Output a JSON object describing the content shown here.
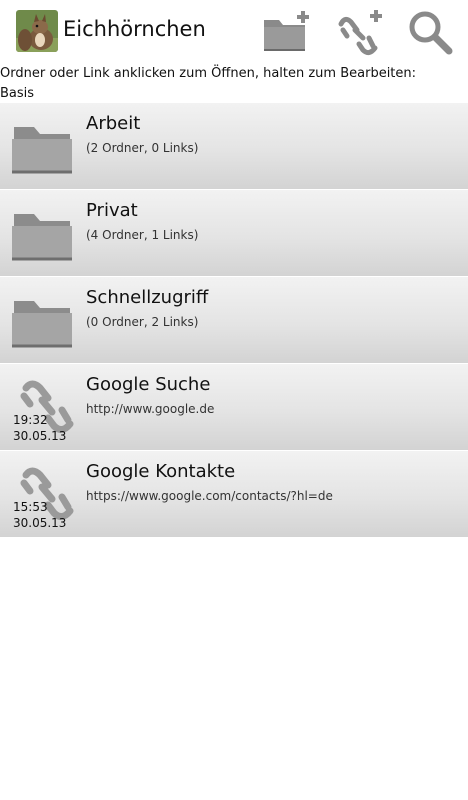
{
  "header": {
    "title": "Eichhörnchen",
    "app_icon": "squirrel-photo",
    "actions": [
      {
        "name": "add-folder-button",
        "icon": "folder-plus-icon"
      },
      {
        "name": "add-link-button",
        "icon": "link-plus-icon"
      },
      {
        "name": "search-button",
        "icon": "search-icon"
      }
    ]
  },
  "hint": "Ordner oder Link anklicken zum Öffnen, halten zum Bearbeiten:",
  "breadcrumb": "Basis",
  "items": [
    {
      "type": "folder",
      "icon": "folder-icon",
      "title": "Arbeit",
      "subtitle": "(2 Ordner, 0 Links)"
    },
    {
      "type": "folder",
      "icon": "folder-icon",
      "title": "Privat",
      "subtitle": "(4 Ordner, 1 Links)"
    },
    {
      "type": "folder",
      "icon": "folder-icon",
      "title": "Schnellzugriff",
      "subtitle": "(0 Ordner, 2 Links)"
    },
    {
      "type": "link",
      "icon": "link-icon",
      "title": "Google Suche",
      "subtitle": "http://www.google.de",
      "time": "19:32",
      "date": "30.05.13"
    },
    {
      "type": "link",
      "icon": "link-icon",
      "title": "Google Kontakte",
      "subtitle": "https://www.google.com/contacts/?hl=de",
      "time": "15:53",
      "date": "30.05.13"
    }
  ],
  "colors": {
    "icon_gray": "#8a8a8a",
    "row_top": "#f2f2f2",
    "row_bottom": "#d3d3d3"
  }
}
